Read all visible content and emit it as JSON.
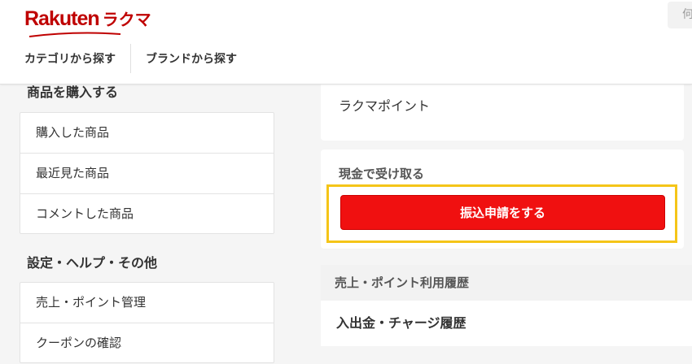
{
  "header": {
    "logo_main": "Rakuten",
    "logo_sub": "ラクマ",
    "search_stub": "何",
    "nav": [
      "カテゴリから探す",
      "ブランドから探す"
    ]
  },
  "sidebar": {
    "purchase_title": "商品を購入する",
    "purchase_items": [
      "購入した商品",
      "最近見た商品",
      "コメントした商品"
    ],
    "settings_title": "設定・ヘルプ・その他",
    "settings_items": [
      "売上・ポイント管理",
      "クーポンの確認"
    ]
  },
  "main": {
    "point_label": "ラクマポイント",
    "cash_title": "現金で受け取る",
    "transfer_button": "振込申請をする",
    "history_title": "売上・ポイント利用履歴",
    "history_item": "入出金・チャージ履歴"
  },
  "colors": {
    "brand": "#bf0000",
    "button": "#f01010",
    "highlight": "#f5c518"
  }
}
